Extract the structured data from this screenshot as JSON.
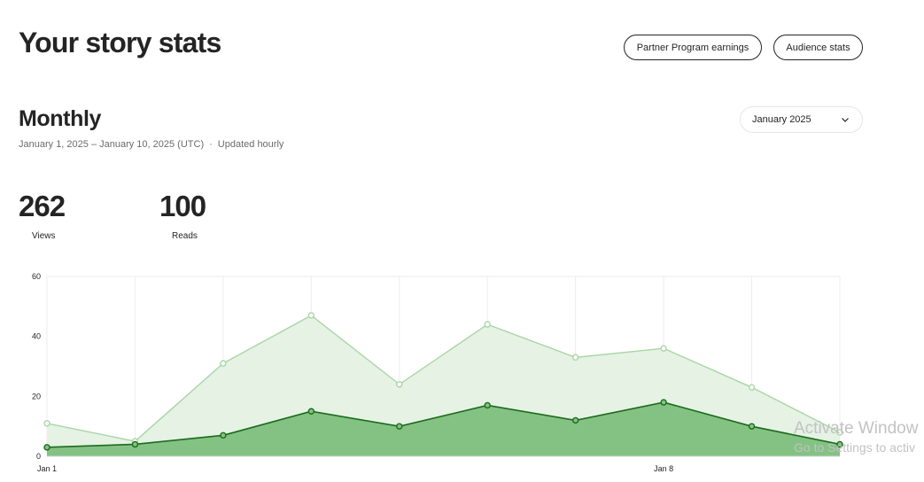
{
  "page": {
    "title": "Your story stats"
  },
  "header_buttons": {
    "partner_program": "Partner Program earnings",
    "audience_stats": "Audience stats"
  },
  "period": {
    "title": "Monthly",
    "date_range": "January 1, 2025 – January 10, 2025 (UTC)",
    "separator": "·",
    "update_note": "Updated hourly",
    "selected_month": "January 2025"
  },
  "stats": {
    "views": {
      "value": "262",
      "label": "Views"
    },
    "reads": {
      "value": "100",
      "label": "Reads"
    }
  },
  "chart_data": {
    "type": "area",
    "x": [
      "Jan 1",
      "Jan 2",
      "Jan 3",
      "Jan 4",
      "Jan 5",
      "Jan 6",
      "Jan 7",
      "Jan 8",
      "Jan 9",
      "Jan 10"
    ],
    "x_tick_labels": [
      {
        "index": 0,
        "label": "Jan 1"
      },
      {
        "index": 7,
        "label": "Jan 8"
      }
    ],
    "ylim": [
      0,
      60
    ],
    "y_ticks": [
      0,
      20,
      40,
      60
    ],
    "grid": true,
    "series": [
      {
        "name": "Views",
        "color": "#a9d6a5",
        "fill": "#e5f2e4",
        "values": [
          11,
          5,
          31,
          47,
          24,
          44,
          33,
          36,
          23,
          8
        ]
      },
      {
        "name": "Reads",
        "color": "#1c6b1c",
        "fill": "#84c284",
        "values": [
          3,
          4,
          7,
          15,
          10,
          17,
          12,
          18,
          10,
          4
        ]
      }
    ]
  },
  "watermark": {
    "line1": "Activate Window",
    "line2": "Go to Settings to activ"
  }
}
